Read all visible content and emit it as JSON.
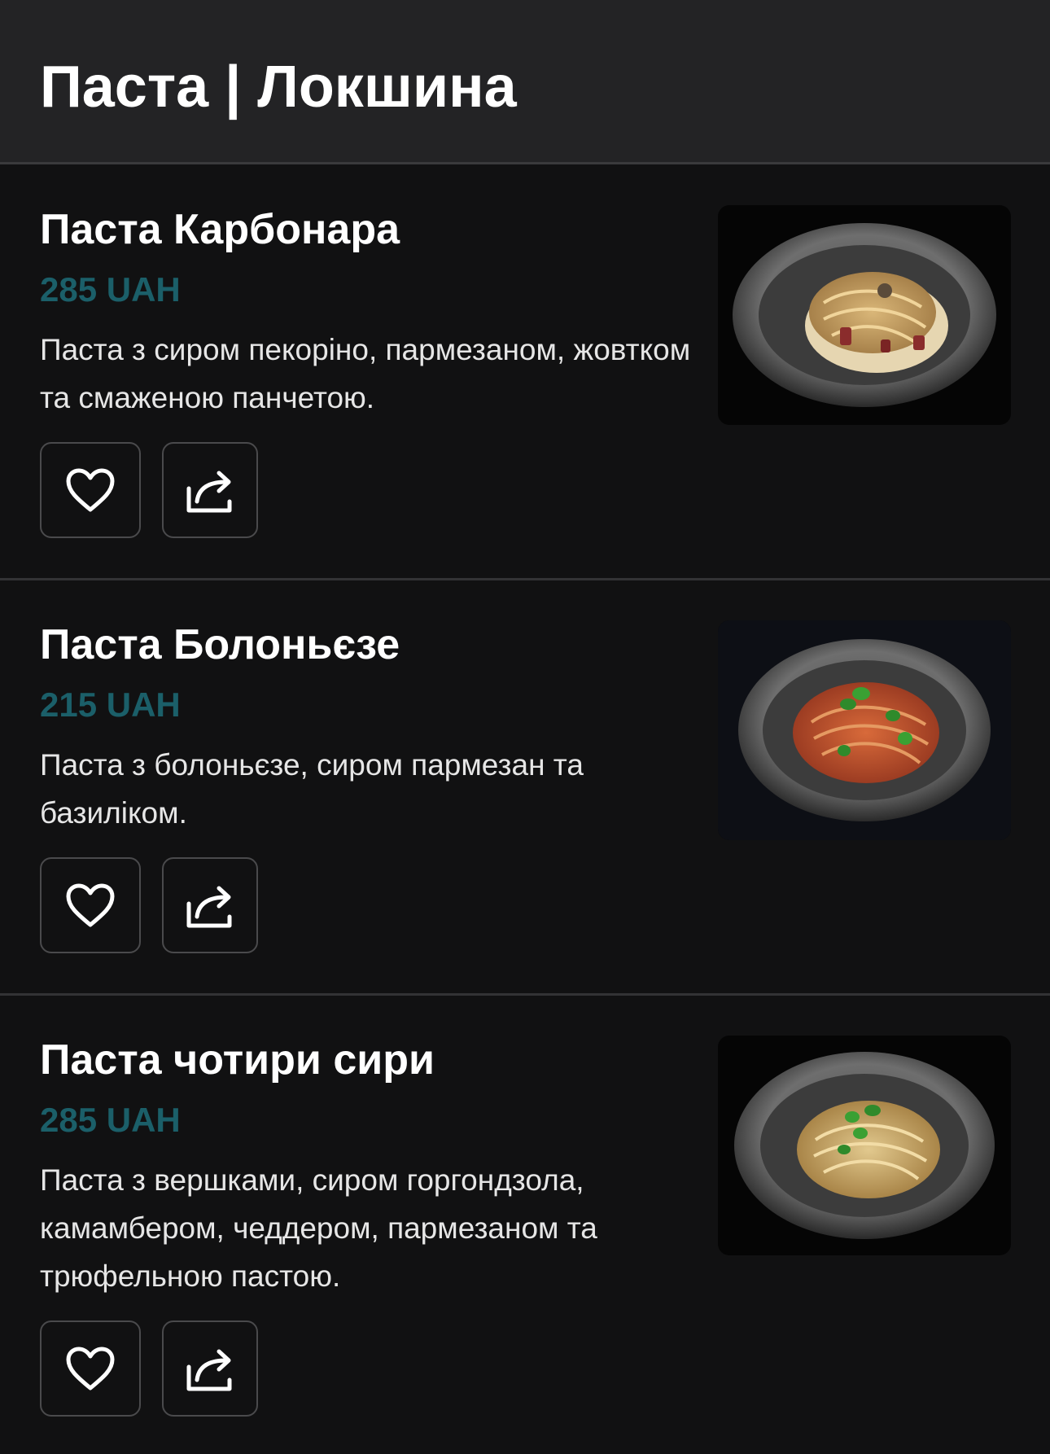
{
  "header": {
    "title": "Паста | Локшина"
  },
  "colors": {
    "price": "#1b5f69",
    "background": "#111112",
    "header_background": "#232325"
  },
  "icons": {
    "favorite": "heart-icon",
    "share": "share-icon"
  },
  "items": [
    {
      "name": "Паста Карбонара",
      "price": "285 UAH",
      "description": "Паста з сиром пекоріно, пармезаном, жовтком та смаженою панчетою."
    },
    {
      "name": "Паста Болоньєзе",
      "price": "215 UAH",
      "description": "Паста з болоньєзе, сиром пармезан та базиліком."
    },
    {
      "name": "Паста чотири сири",
      "price": "285 UAH",
      "description": "Паста з вершками, сиром горгондзола, камамбером, чеддером, пармезаном та трюфельною пастою."
    }
  ]
}
